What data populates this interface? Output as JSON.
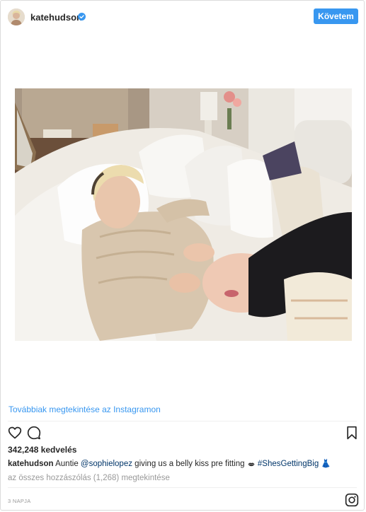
{
  "header": {
    "username": "katehudson",
    "verified": true,
    "follow_label": "Követem"
  },
  "post": {
    "view_more_label": "Továbbiak megtekintése az Instagramon",
    "likes_text": "342,248 kedvelés",
    "caption": {
      "user": "katehudson",
      "text_before_mention": "Auntie ",
      "mention": "@sophielopez",
      "text_after_mention": " giving us a belly kiss pre fitting ",
      "hashtag": "#ShesGettingBig",
      "trailing_emoji": "👗"
    },
    "comments_link": "az összes hozzászólás (1,268) megtekintése",
    "date": "3 NAPJA"
  },
  "icons": {
    "like": "heart-icon",
    "comment": "comment-icon",
    "save": "bookmark-icon",
    "instagram": "instagram-logo-icon",
    "verified": "verified-badge-icon",
    "kiss": "kiss-lips-icon"
  },
  "colors": {
    "accent": "#3897f0",
    "link": "#3897f0",
    "mention": "#003569",
    "muted": "#999999",
    "text": "#262626",
    "border": "#dbdbdb"
  }
}
